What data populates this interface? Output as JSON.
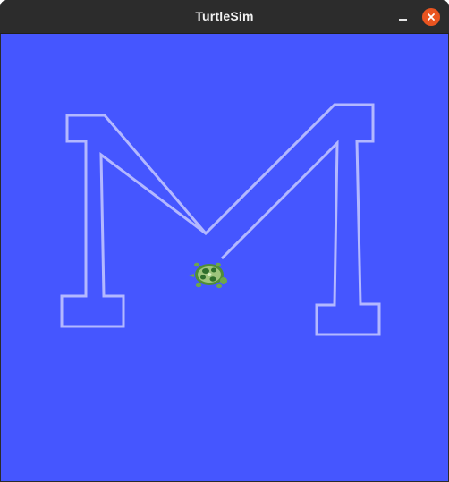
{
  "window": {
    "title": "TurtleSim"
  },
  "titlebar_buttons": {
    "minimize_icon": "minimize-icon",
    "close_icon": "close-icon"
  },
  "canvas": {
    "background_color": "#4556ff",
    "pen_color": "#b3b8ff",
    "turtle_icon": "turtle-icon"
  },
  "colors": {
    "titlebar": "#2c2c2c",
    "title_text": "#f2f2f2",
    "close_button": "#e95420"
  }
}
